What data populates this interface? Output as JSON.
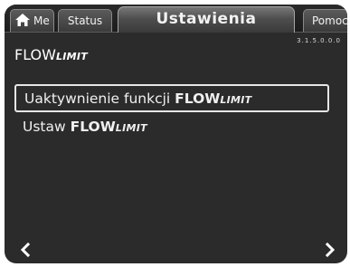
{
  "tabs": [
    {
      "label": "Me",
      "icon": "home-icon"
    },
    {
      "label": "Status"
    },
    {
      "label": "Ustawienia",
      "active": true
    },
    {
      "label": "Pomoc"
    }
  ],
  "screen": {
    "title_main": "FLOW",
    "title_suffix": "LIMIT",
    "code": "3.1.5.0.0.0"
  },
  "menu": [
    {
      "prefix": "Uaktywnienie funkcji ",
      "brand": "FLOW",
      "suffix": "LIMIT",
      "selected": true
    },
    {
      "prefix": "Ustaw ",
      "brand": "FLOW",
      "suffix": "LIMIT",
      "selected": false
    }
  ],
  "nav": {
    "back_icon": "chevron-left-icon",
    "forward_icon": "chevron-right-icon"
  },
  "colors": {
    "background": "#2b2b2b",
    "text": "#ffffff",
    "selection_border": "#e6e6e6"
  }
}
